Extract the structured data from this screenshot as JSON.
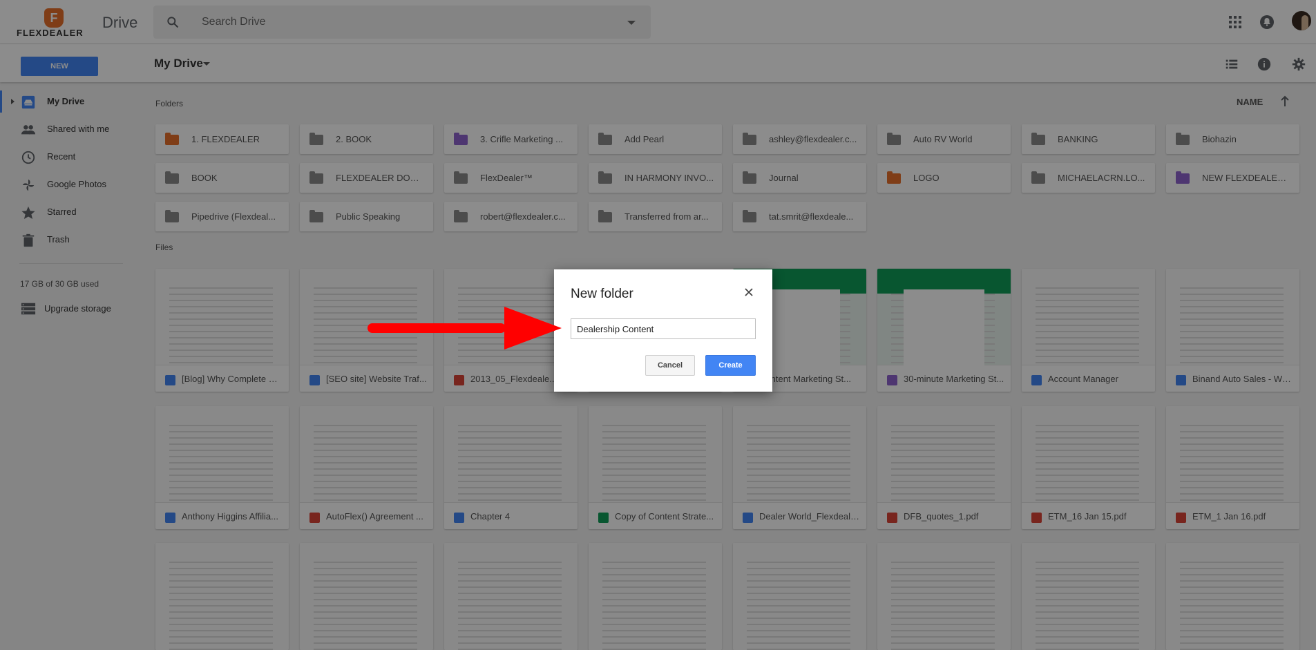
{
  "header": {
    "logo_text": "FLEXDEALER",
    "app_title": "Drive",
    "search_placeholder": "Search Drive",
    "icons": [
      "apps-grid-icon",
      "notifications-icon",
      "avatar"
    ]
  },
  "toolbar": {
    "new_label": "NEW",
    "breadcrumb": "My Drive",
    "icons": [
      "list-view-icon",
      "info-icon",
      "settings-gear-icon"
    ]
  },
  "sidebar": {
    "items": [
      {
        "label": "My Drive",
        "icon": "drive-icon",
        "active": true
      },
      {
        "label": "Shared with me",
        "icon": "people-icon",
        "active": false
      },
      {
        "label": "Recent",
        "icon": "clock-icon",
        "active": false
      },
      {
        "label": "Google Photos",
        "icon": "pinwheel-icon",
        "active": false
      },
      {
        "label": "Starred",
        "icon": "star-icon",
        "active": false
      },
      {
        "label": "Trash",
        "icon": "trash-icon",
        "active": false
      }
    ],
    "storage_text": "17 GB of 30 GB used",
    "upgrade_label": "Upgrade storage"
  },
  "content": {
    "folders_label": "Folders",
    "files_label": "Files",
    "sort_label": "NAME",
    "folders": [
      {
        "name": "1. FLEXDEALER",
        "color": "#e8702a"
      },
      {
        "name": "2. BOOK",
        "color": "#8a8a8a"
      },
      {
        "name": "3. Crifle Marketing ...",
        "color": "#8e63ce"
      },
      {
        "name": "Add Pearl",
        "color": "#8a8a8a"
      },
      {
        "name": "ashley@flexdealer.c...",
        "color": "#8a8a8a"
      },
      {
        "name": "Auto RV World",
        "color": "#8a8a8a"
      },
      {
        "name": "BANKING",
        "color": "#8a8a8a"
      },
      {
        "name": "Biohazin",
        "color": "#8a8a8a"
      },
      {
        "name": "BOOK",
        "color": "#8a8a8a"
      },
      {
        "name": "FLEXDEALER DOCS ...",
        "color": "#8a8a8a"
      },
      {
        "name": "FlexDealer™",
        "color": "#8a8a8a"
      },
      {
        "name": "IN HARMONY INVO...",
        "color": "#8a8a8a"
      },
      {
        "name": "Journal",
        "color": "#8a8a8a"
      },
      {
        "name": "LOGO",
        "color": "#e8702a"
      },
      {
        "name": "MICHAELACRN.LO...",
        "color": "#8a8a8a"
      },
      {
        "name": "NEW FLEXDEALER ...",
        "color": "#8e63ce"
      },
      {
        "name": "Pipedrive (Flexdeal...",
        "color": "#8a8a8a"
      },
      {
        "name": "Public Speaking",
        "color": "#8a8a8a"
      },
      {
        "name": "robert@flexdealer.c...",
        "color": "#8a8a8a"
      },
      {
        "name": "Transferred from ar...",
        "color": "#8a8a8a"
      },
      {
        "name": "tat.smrit@flexdeale...",
        "color": "#8a8a8a"
      }
    ],
    "files_row1": [
      {
        "name": "[Blog] Why Complete W...",
        "color": "#4285f4",
        "thumb": "doc"
      },
      {
        "name": "[SEO site] Website Traf...",
        "color": "#4285f4",
        "thumb": "doc"
      },
      {
        "name": "2013_05_Flexdeale...",
        "color": "#db4437",
        "thumb": "doc"
      },
      {
        "name": "",
        "color": "#0f9d58",
        "thumb": "doc"
      },
      {
        "name": "Content Marketing St...",
        "color": "#0f9d58",
        "thumb": "green"
      },
      {
        "name": "30-minute Marketing St...",
        "color": "#8e63ce",
        "thumb": "green"
      },
      {
        "name": "Account Manager",
        "color": "#4285f4",
        "thumb": "doc"
      },
      {
        "name": "Binand Auto Sales - We...",
        "color": "#4285f4",
        "thumb": "doc"
      }
    ],
    "files_row2": [
      {
        "name": "Anthony Higgins Affilia...",
        "color": "#4285f4",
        "thumb": "doc"
      },
      {
        "name": "AutoFlex() Agreement ...",
        "color": "#db4437",
        "thumb": "doc"
      },
      {
        "name": "Chapter 4",
        "color": "#4285f4",
        "thumb": "doc"
      },
      {
        "name": "Copy of Content Strate...",
        "color": "#0f9d58",
        "thumb": "doc"
      },
      {
        "name": "Dealer World_Flexdeale...",
        "color": "#4285f4",
        "thumb": "doc"
      },
      {
        "name": "DFB_quotes_1.pdf",
        "color": "#db4437",
        "thumb": "doc"
      },
      {
        "name": "ETM_16 Jan 15.pdf",
        "color": "#db4437",
        "thumb": "doc"
      },
      {
        "name": "ETM_1 Jan 16.pdf",
        "color": "#db4437",
        "thumb": "doc"
      }
    ],
    "files_row3": [
      {
        "name": "",
        "color": "#0f9d58",
        "thumb": "doc"
      },
      {
        "name": "",
        "color": "#4285f4",
        "thumb": "doc"
      },
      {
        "name": "",
        "color": "#e8702a",
        "thumb": "doc"
      },
      {
        "name": "",
        "color": "#4285f4",
        "thumb": "doc"
      },
      {
        "name": "",
        "color": "#4285f4",
        "thumb": "doc"
      },
      {
        "name": "",
        "color": "#4285f4",
        "thumb": "doc"
      },
      {
        "name": "",
        "color": "#db4437",
        "thumb": "doc"
      },
      {
        "name": "",
        "color": "#0f9d58",
        "thumb": "doc"
      }
    ]
  },
  "dialog": {
    "title": "New folder",
    "input_value": "Dealership Content",
    "cancel_label": "Cancel",
    "create_label": "Create",
    "accent": "#4285f4"
  },
  "annotation": {
    "arrow_color": "#ff0000"
  }
}
